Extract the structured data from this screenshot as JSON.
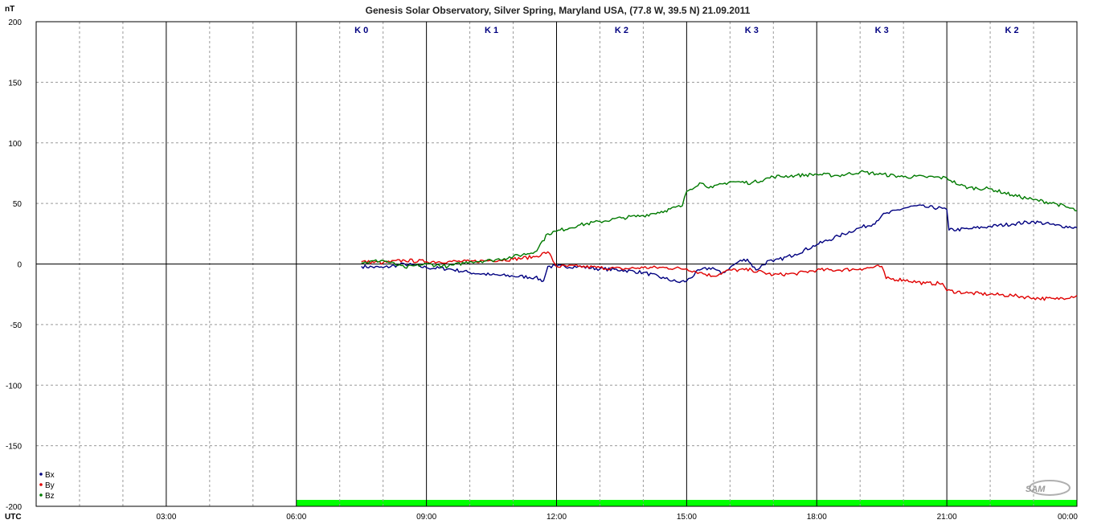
{
  "chart_data": {
    "type": "line",
    "title": "Genesis Solar Observatory, Silver Spring, Maryland USA, (77.8 W, 39.5 N)  21.09.2011",
    "ylabel": "nT",
    "xlabel": "UTC",
    "ylim": [
      -200,
      200
    ],
    "xlim": [
      0,
      24
    ],
    "y_ticks": [
      200,
      150,
      100,
      50,
      0,
      -50,
      -100,
      -150,
      -200
    ],
    "y_tick_labels": [
      "200",
      "150",
      "100",
      "50",
      "0",
      "-50",
      "-100",
      "-150",
      "-200"
    ],
    "x_ticks": [
      3,
      6,
      9,
      12,
      15,
      18,
      21,
      24
    ],
    "x_tick_labels": [
      "03:00",
      "06:00",
      "09:00",
      "12:00",
      "15:00",
      "18:00",
      "21:00",
      "00:00"
    ],
    "grid": true,
    "legend_position": "bottom-left",
    "k_index": [
      {
        "label": "K 0",
        "x": 7.5
      },
      {
        "label": "K 1",
        "x": 10.5
      },
      {
        "label": "K 2",
        "x": 13.5
      },
      {
        "label": "K 3",
        "x": 16.5
      },
      {
        "label": "K 3",
        "x": 19.5
      },
      {
        "label": "K 2",
        "x": 22.5
      }
    ],
    "data_coverage": [
      6,
      24
    ],
    "colors": {
      "Bx": "#000080",
      "By": "#e00000",
      "Bz": "#007a00",
      "coverage": "#00ff00"
    },
    "series": [
      {
        "name": "Bx",
        "x": [
          7.5,
          8.0,
          8.5,
          9.0,
          9.5,
          10.0,
          10.5,
          11.0,
          11.5,
          11.7,
          11.8,
          12.0,
          12.5,
          13.0,
          13.5,
          14.0,
          14.5,
          14.8,
          15.0,
          15.3,
          15.6,
          15.8,
          16.0,
          16.2,
          16.4,
          16.6,
          16.9,
          17.0,
          17.5,
          18.0,
          18.5,
          19.0,
          19.3,
          19.5,
          20.0,
          20.3,
          20.5,
          20.9,
          21.0,
          21.05,
          21.5,
          22.0,
          22.5,
          23.0,
          23.5,
          24.0
        ],
        "values": [
          -2,
          -3,
          0,
          -3,
          -4,
          -7,
          -9,
          -10,
          -11,
          -14,
          -2,
          -2,
          -2,
          -4,
          -5,
          -7,
          -12,
          -15,
          -14,
          -5,
          -3,
          -8,
          -3,
          2,
          4,
          -5,
          3,
          2,
          8,
          16,
          23,
          30,
          33,
          40,
          46,
          48,
          47,
          46,
          45,
          28,
          29,
          31,
          33,
          35,
          32,
          30
        ]
      },
      {
        "name": "By",
        "x": [
          7.5,
          8.0,
          8.5,
          9.0,
          9.5,
          10.0,
          10.5,
          11.0,
          11.5,
          11.8,
          12.0,
          12.5,
          13.0,
          13.5,
          14.0,
          14.5,
          15.0,
          15.3,
          15.6,
          16.0,
          16.5,
          17.0,
          17.5,
          18.0,
          18.5,
          19.0,
          19.5,
          19.6,
          20.0,
          20.5,
          20.9,
          21.0,
          21.5,
          22.0,
          22.5,
          23.0,
          23.5,
          24.0
        ],
        "values": [
          2,
          1,
          3,
          2,
          2,
          2,
          3,
          4,
          6,
          10,
          -2,
          -2,
          -3,
          -4,
          -3,
          -3,
          -4,
          -7,
          -10,
          -5,
          -5,
          -9,
          -8,
          -5,
          -5,
          -4,
          -2,
          -12,
          -13,
          -16,
          -16,
          -22,
          -24,
          -25,
          -26,
          -28,
          -29,
          -26
        ]
      },
      {
        "name": "Bz",
        "x": [
          7.5,
          8.0,
          8.5,
          9.0,
          9.5,
          10.0,
          10.5,
          11.0,
          11.5,
          11.8,
          12.0,
          12.5,
          13.0,
          13.5,
          14.0,
          14.5,
          14.9,
          15.0,
          15.3,
          15.6,
          16.0,
          16.5,
          17.0,
          17.5,
          18.0,
          18.5,
          19.0,
          19.5,
          20.0,
          20.5,
          21.0,
          21.3,
          21.5,
          22.0,
          22.5,
          23.0,
          23.5,
          24.0
        ],
        "values": [
          1,
          3,
          -3,
          0,
          -2,
          2,
          3,
          6,
          10,
          25,
          27,
          32,
          35,
          38,
          40,
          44,
          48,
          60,
          67,
          63,
          68,
          67,
          72,
          73,
          74,
          73,
          76,
          74,
          72,
          72,
          71,
          65,
          63,
          62,
          57,
          53,
          50,
          44
        ]
      }
    ]
  }
}
